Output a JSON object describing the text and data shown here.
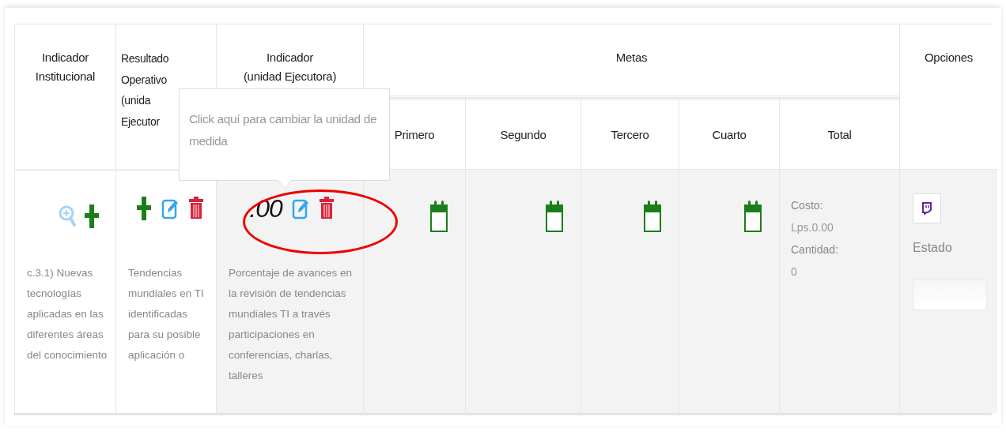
{
  "table": {
    "headers": [
      {
        "lines": [
          "Indicador",
          "Institucional"
        ]
      },
      {
        "lines": [
          "Resultado",
          "Operativo",
          "(unida",
          "Ejecutor"
        ]
      },
      {
        "lines": [
          "Indicador",
          "(unidad Ejecutora)"
        ]
      }
    ],
    "metas": {
      "label": "Metas",
      "columns": [
        "Primero",
        "Segundo",
        "Tercero",
        "Cuarto",
        "Total"
      ]
    },
    "options_label": "Opciones",
    "row": {
      "cells": [
        {
          "icons": [
            {
              "kind": "zoom"
            },
            {
              "kind": "add"
            }
          ],
          "text": "c.3.1) Nuevas tecnologías aplicadas en las diferentes áreas del conocimiento"
        },
        {
          "icons": [
            {
              "kind": "add"
            },
            {
              "kind": "edit"
            },
            {
              "kind": "delete"
            }
          ],
          "text": "Tendencias mundiales en TI identificadas para su posible aplicación o"
        },
        {
          "value": ".00",
          "icons": [
            {
              "kind": "edit"
            },
            {
              "kind": "delete"
            }
          ],
          "text": "Porcentaje de avances en la revisión de tendencias mundiales TI a través participaciones en conferencias, charlas, talleres"
        }
      ],
      "goals": [
        {
          "kind": "calendar"
        },
        {
          "kind": "calendar"
        },
        {
          "kind": "calendar"
        },
        {
          "kind": "calendar"
        }
      ],
      "total": {
        "cost_label": "Costo:",
        "cost": "Lps.0.00",
        "quantity_label": "Cantidad:",
        "quantity": "0"
      },
      "options": {
        "status_label": "Estado"
      }
    }
  },
  "tooltip": {
    "text": "Click aquí para cambiar la unidad de medida"
  },
  "highlight": {
    "kind": "ellipse"
  }
}
